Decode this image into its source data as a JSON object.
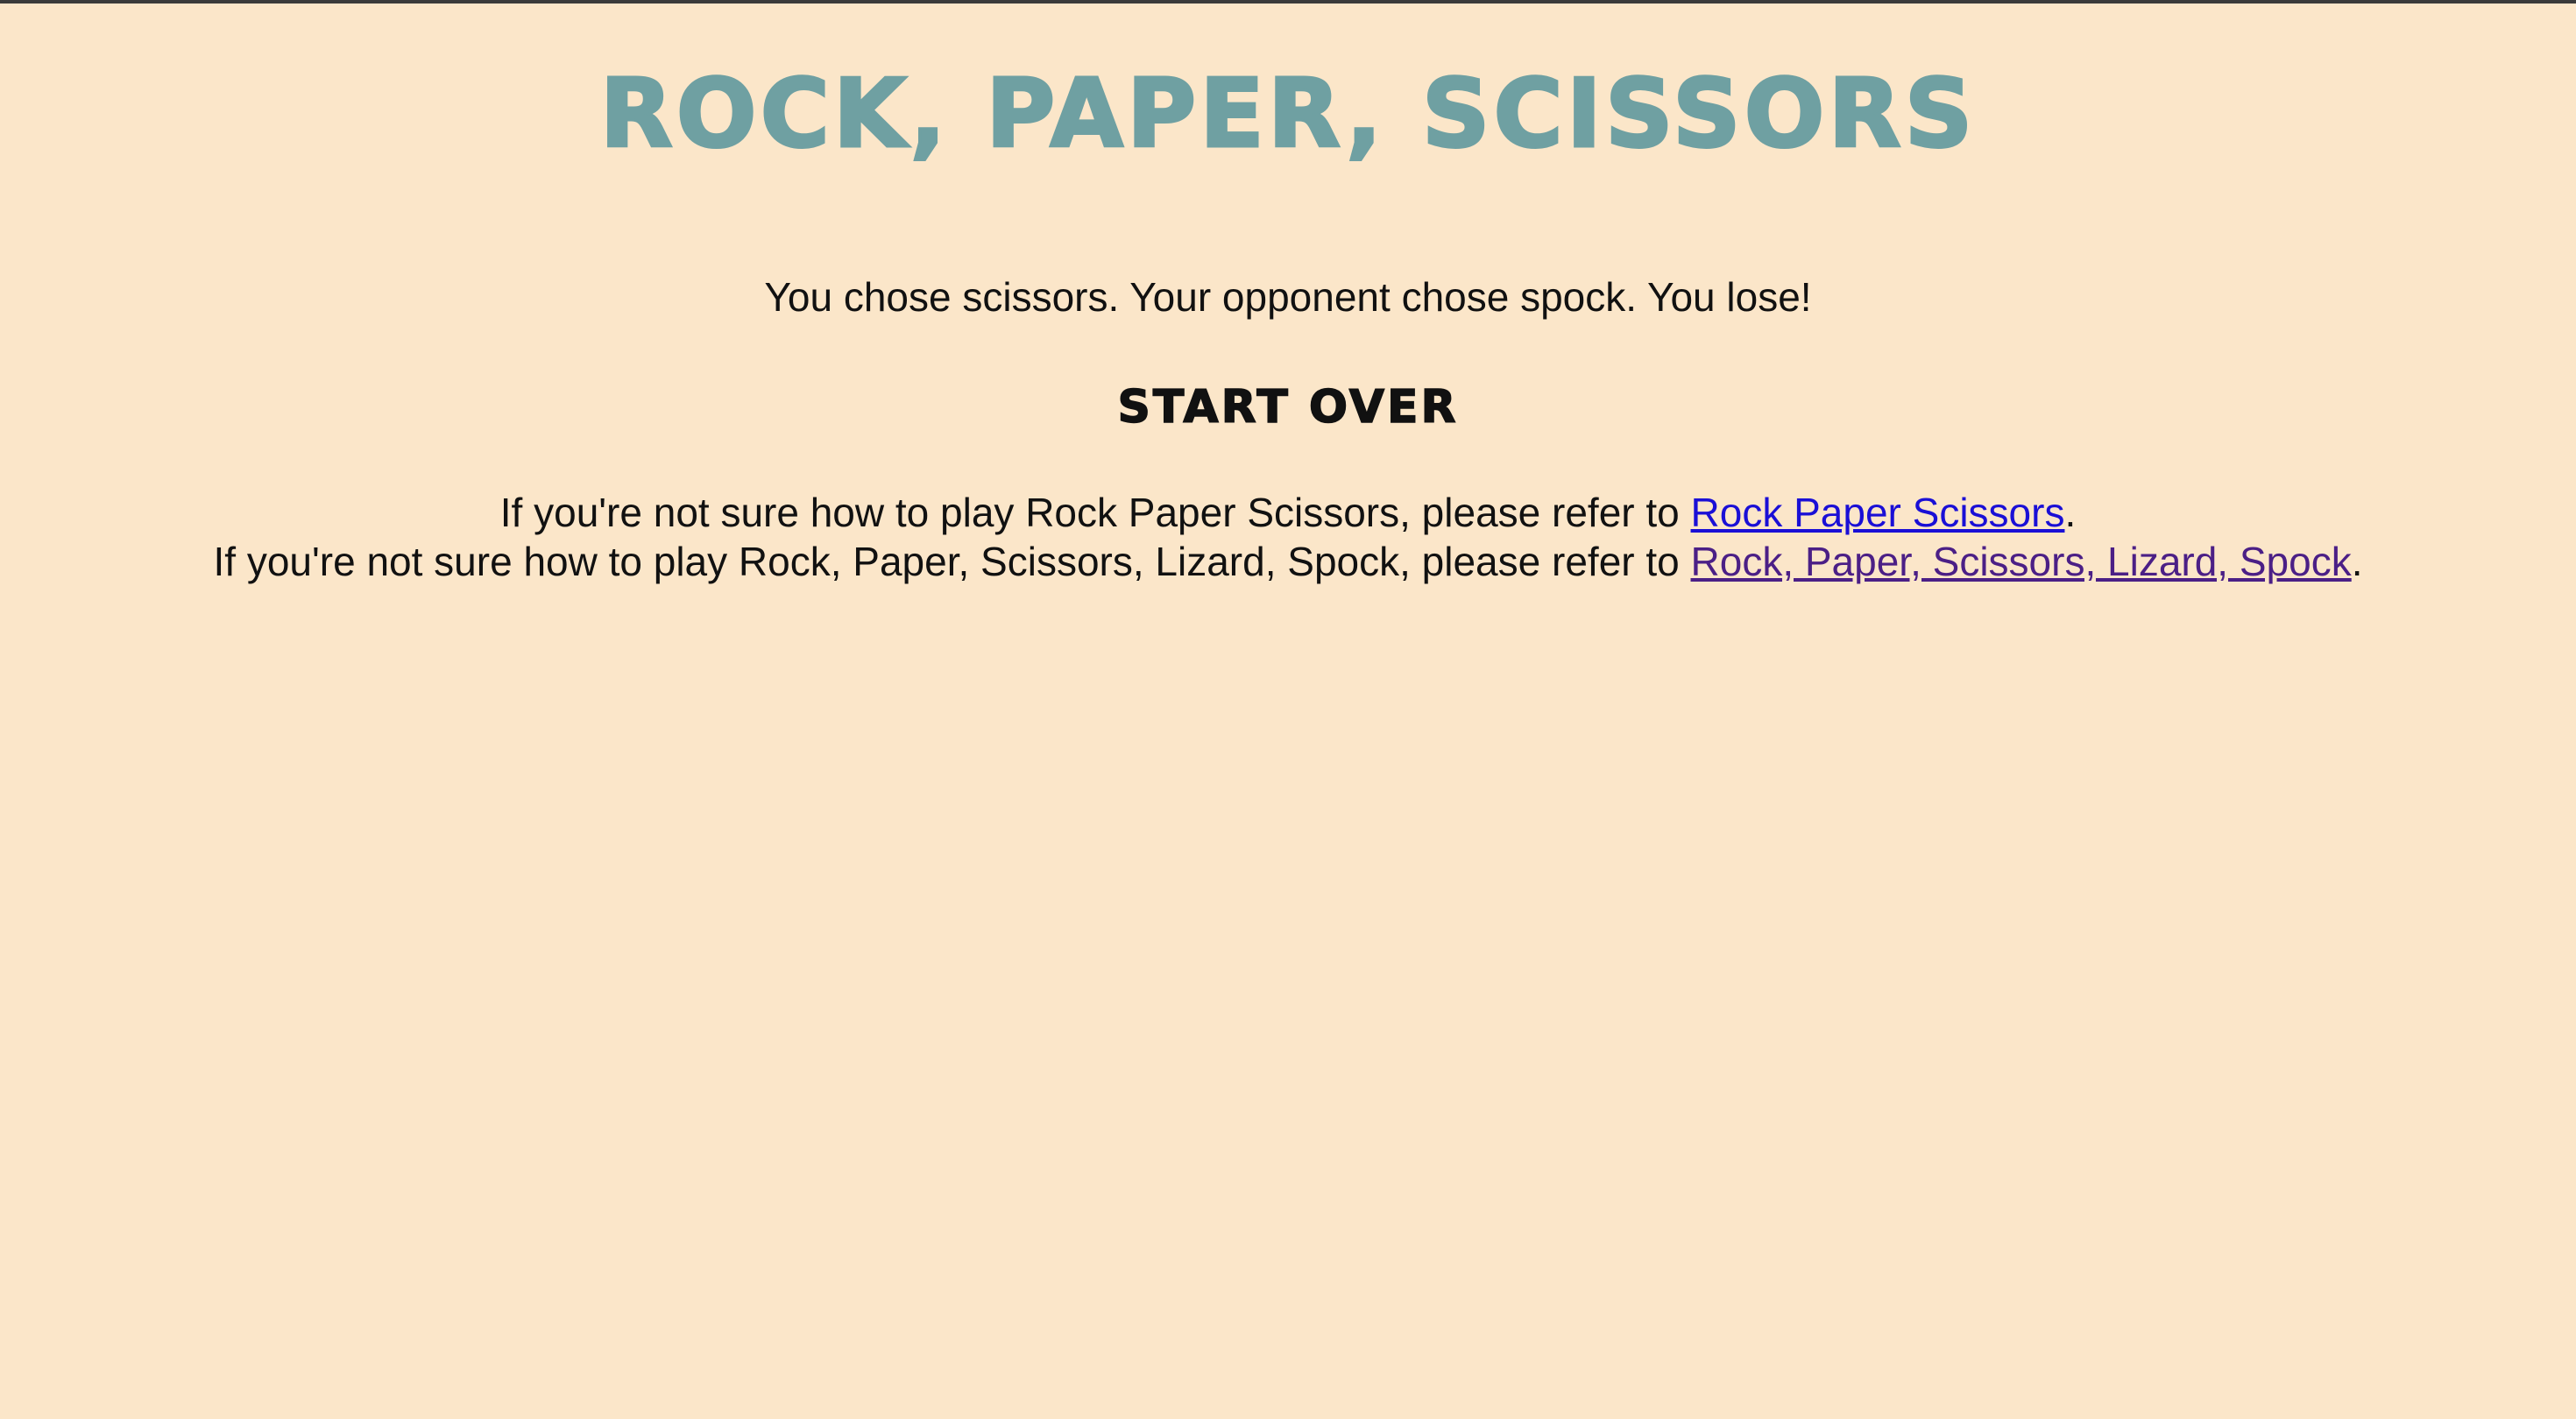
{
  "header": {
    "title": "ROCK, PAPER, SCISSORS"
  },
  "result": {
    "text": "You chose scissors. Your opponent chose spock. You lose!"
  },
  "actions": {
    "start_over_label": "START OVER"
  },
  "help": {
    "line1_prefix": "If you're not sure how to play Rock Paper Scissors, please refer to ",
    "line1_link": "Rock Paper Scissors",
    "line1_suffix": ".",
    "line2_prefix": "If you're not sure how to play Rock, Paper, Scissors, Lizard, Spock, please refer to ",
    "line2_link": "Rock, Paper, Scissors, Lizard, Spock",
    "line2_suffix": "."
  },
  "colors": {
    "background": "#fbe6c9",
    "title": "#6fa0a2",
    "link": "#1a0fd6",
    "visited_link": "#4b1f86",
    "text": "#111111"
  }
}
